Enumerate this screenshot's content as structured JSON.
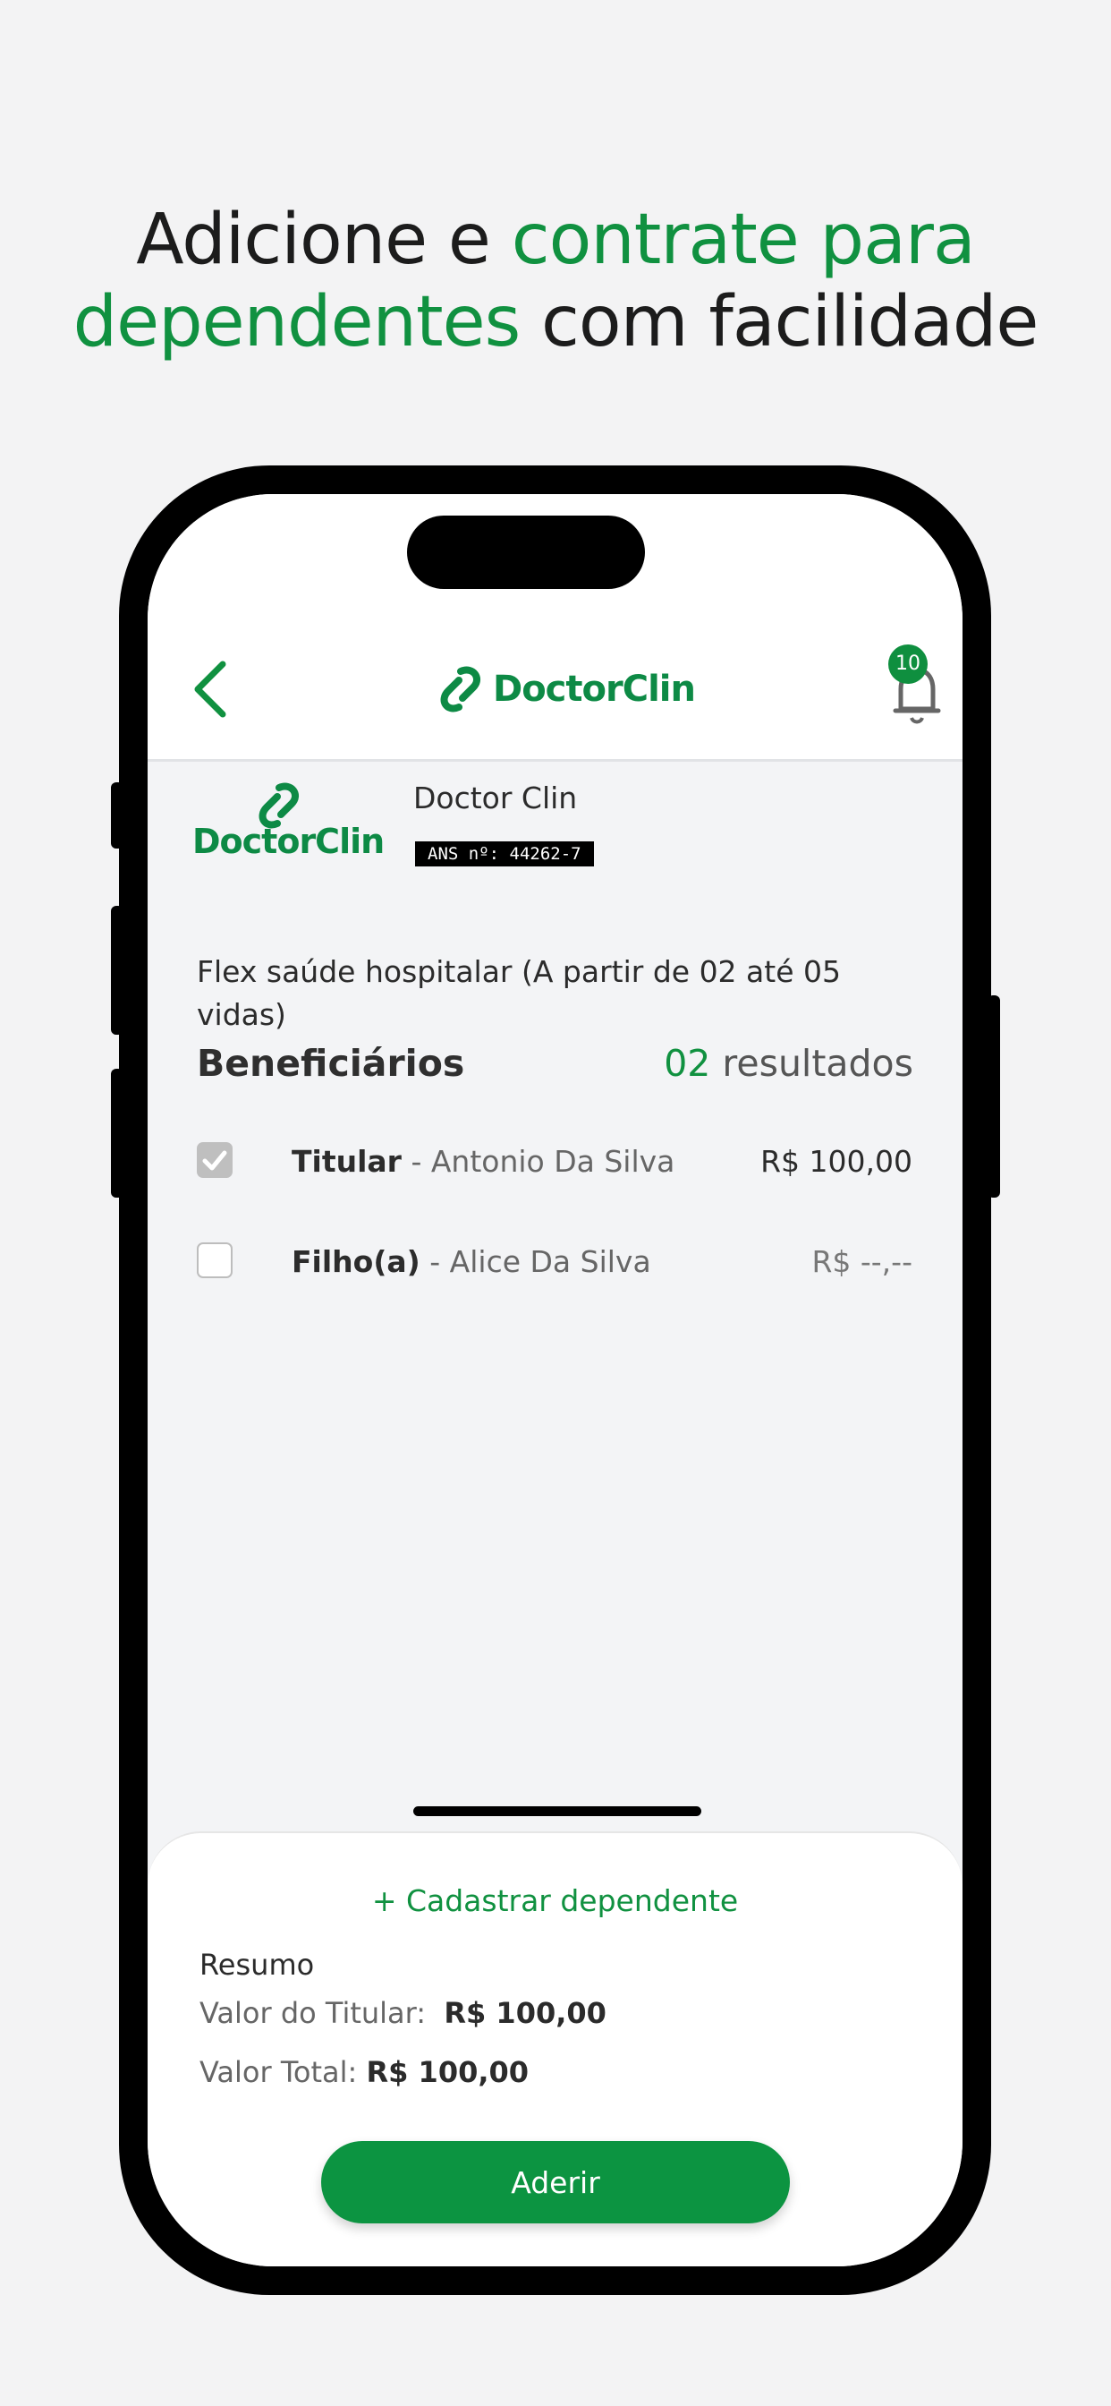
{
  "headline": {
    "part1": "Adicione e ",
    "part2": "contrate para",
    "part3": "dependentes",
    "part4": " com facilidade"
  },
  "appbar": {
    "logo_text": "DoctorClin",
    "notification_count": "10"
  },
  "provider": {
    "logo_text": "DoctorClin",
    "name": "Doctor Clin",
    "ans": "ANS nº: 44262-7"
  },
  "plan": {
    "title": "Flex saúde hospitalar (A partir de 02 até 05 vidas)"
  },
  "beneficiaries": {
    "title": "Beneficiários",
    "count": "02",
    "count_suffix": " resultados",
    "items": [
      {
        "role": "Titular",
        "separator": " - ",
        "name": "Antonio Da Silva",
        "price": "R$ 100,00",
        "checked": true
      },
      {
        "role": "Filho(a)",
        "separator": " - ",
        "name": "Alice Da Silva",
        "price": "R$ --,--",
        "checked": false
      }
    ]
  },
  "sheet": {
    "add_dependent": "+ Cadastrar dependente",
    "summary_title": "Resumo",
    "holder_label": "Valor do Titular:",
    "holder_value": "R$ 100,00",
    "total_label": "Valor Total:",
    "total_value": "R$ 100,00",
    "submit_label": "Aderir"
  },
  "colors": {
    "brand_green": "#109140",
    "button_green": "#0c9441"
  }
}
